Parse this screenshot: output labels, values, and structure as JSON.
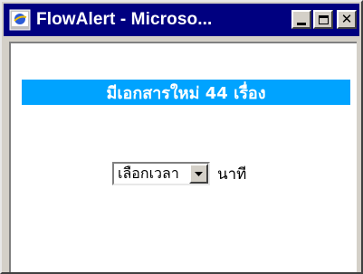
{
  "window": {
    "title": "FlowAlert - Microso...",
    "minimize_label": "",
    "maximize_label": "",
    "close_label": "✕"
  },
  "banner": {
    "text": "มีเอกสารใหม่ 44 เรื่อง"
  },
  "interval": {
    "selected": "เลือกเวลา",
    "unit": "นาที"
  },
  "colors": {
    "titlebar": "#000080",
    "banner": "#00a3ff",
    "chrome": "#d4d0c8"
  }
}
